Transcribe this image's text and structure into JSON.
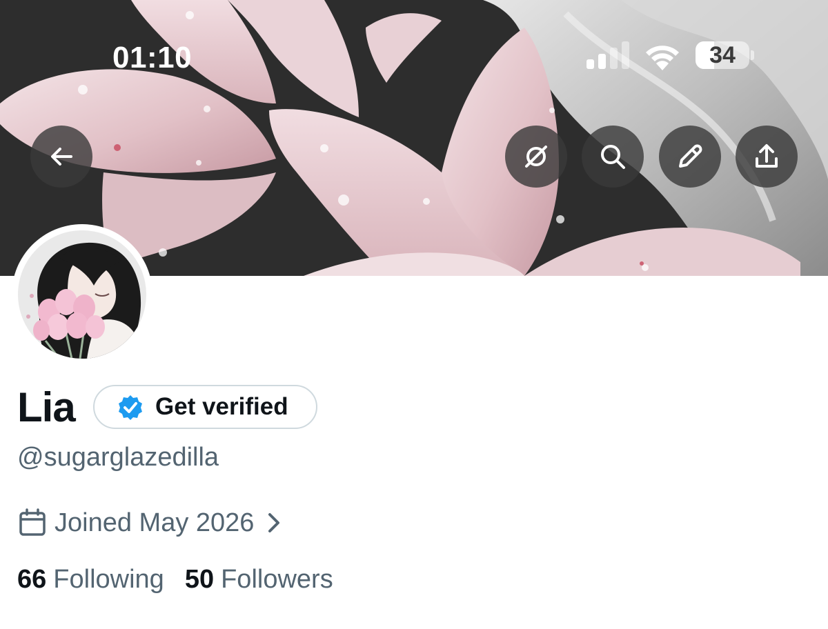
{
  "status_bar": {
    "time": "01:10",
    "battery_level": "34",
    "battery_fraction": 0.34,
    "signal_bars_active": 2,
    "icons": [
      "signal-icon",
      "wifi-icon",
      "battery-icon"
    ]
  },
  "header_actions": {
    "back_icon": "arrow-left-icon",
    "grok_icon": "grok-slash-icon",
    "search_icon": "search-icon",
    "edit_icon": "pencil-icon",
    "share_icon": "share-icon"
  },
  "profile": {
    "display_name": "Lia",
    "verify_label": "Get verified",
    "handle": "@sugarglazedilla",
    "joined": "Joined May 2026",
    "following_count": "66",
    "following_label": "Following",
    "followers_count": "50",
    "followers_label": "Followers"
  },
  "colors": {
    "verified_blue": "#1d9bf0",
    "text_primary": "#0f1419",
    "text_secondary": "#536471",
    "border": "#cfd9de"
  }
}
